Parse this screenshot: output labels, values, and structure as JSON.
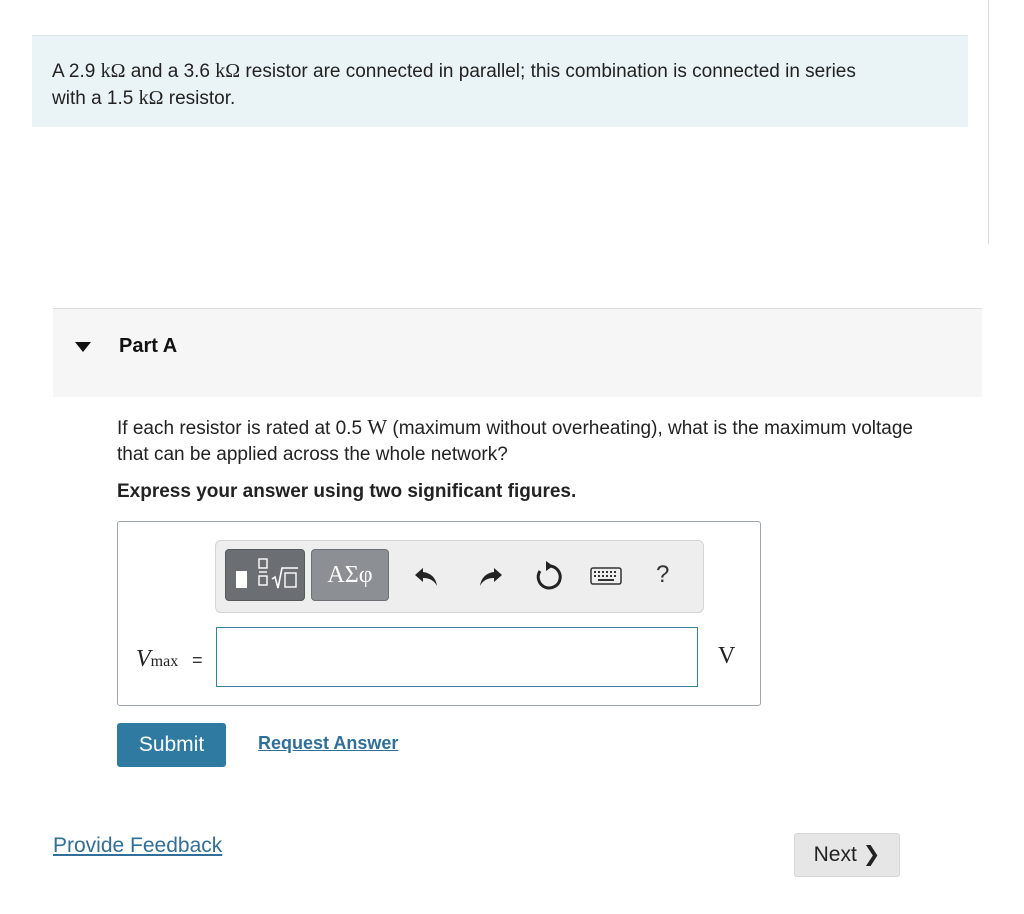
{
  "intro": {
    "line1_a": "A 2.9 ",
    "unit1": "kΩ",
    "line1_b": " and a 3.6 ",
    "unit2": "kΩ",
    "line1_c": " resistor are connected in parallel; this combination is connected in series",
    "line2_a": "with a 1.5 ",
    "unit3": "kΩ",
    "line2_b": " resistor."
  },
  "part": {
    "title": "Part A"
  },
  "question": {
    "text_a": "If each resistor is rated at 0.5 ",
    "unit": "W",
    "text_b": " (maximum without overheating), what is the maximum voltage",
    "text_c": "that can be applied across the whole network?",
    "instruction": "Express your answer using two significant figures."
  },
  "toolbar": {
    "greek_label": "ΑΣφ",
    "help_label": "?",
    "icons": [
      "templates-icon",
      "greek-letters-icon",
      "undo-icon",
      "redo-icon",
      "reset-icon",
      "keyboard-icon",
      "help-icon"
    ]
  },
  "answer": {
    "var": "V",
    "var_sub": "max",
    "equals": "=",
    "value": "",
    "unit": "V"
  },
  "actions": {
    "submit_label": "Submit",
    "request_label": "Request Answer",
    "feedback_label": "Provide Feedback",
    "next_label": "Next",
    "next_chevron": "❯"
  },
  "colors": {
    "accent": "#2f7aa0",
    "intro_bg": "#eaf4f6",
    "link": "#2f6f9a"
  }
}
